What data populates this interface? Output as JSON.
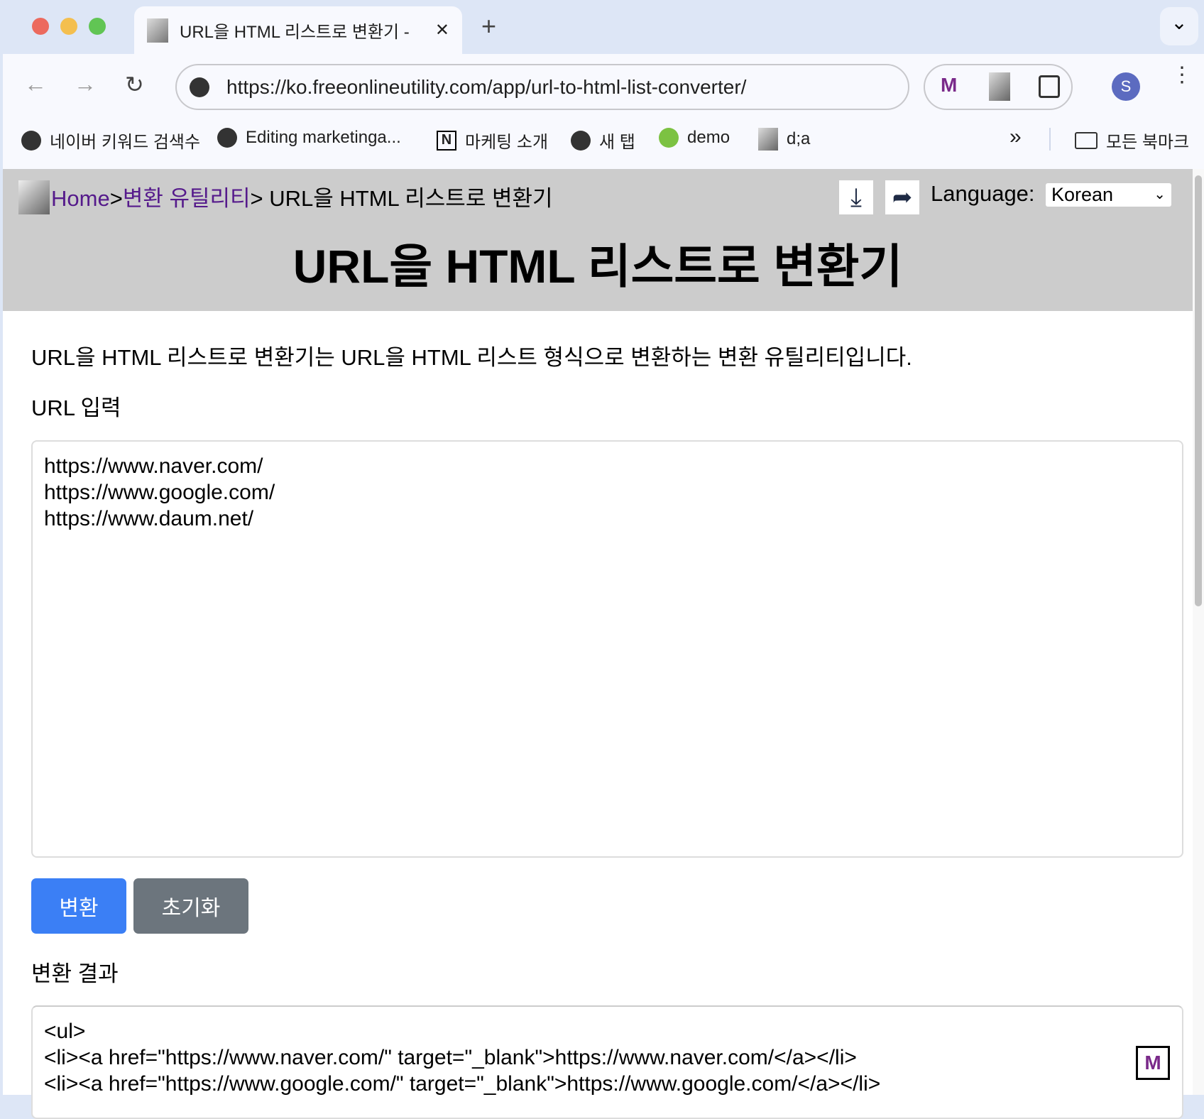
{
  "browser": {
    "tab_title": "URL을 HTML 리스트로 변환기 - ",
    "tab_close": "✕",
    "new_tab": "+",
    "tab_menu": "⌄",
    "url": "https://ko.freeonlineutility.com/app/url-to-html-list-converter/",
    "avatar": "S",
    "bookmarks": [
      "네이버 키워드 검색수",
      "Editing marketinga...",
      "마케팅 소개",
      "새 탭",
      "demo",
      "d;a"
    ],
    "more_bookmarks": "»",
    "all_bookmarks": "모든 북마크"
  },
  "header": {
    "breadcrumb_home": "Home",
    "sep1": ">",
    "breadcrumb_cat": "변환 유틸리티",
    "breadcrumb_current": "> URL을 HTML 리스트로 변환기",
    "language_label": "Language:",
    "language_value": "Korean",
    "title": "URL을 HTML 리스트로 변환기"
  },
  "main": {
    "description": "URL을 HTML 리스트로 변환기는 URL을 HTML 리스트 형식으로 변환하는 변환 유틸리티입니다.",
    "input_label": "URL 입력",
    "input_value": "https://www.naver.com/\nhttps://www.google.com/\nhttps://www.daum.net/",
    "convert_label": "변환",
    "reset_label": "초기화",
    "output_label": "변환 결과",
    "output_value": "<ul>\n<li><a href=\"https://www.naver.com/\" target=\"_blank\">https://www.naver.com/</a></li>\n<li><a href=\"https://www.google.com/\" target=\"_blank\">https://www.google.com/</a></li>"
  },
  "colors": {
    "primary": "#3b7ff5",
    "secondary": "#6c757d",
    "link": "#551a8b",
    "header_bg": "#cccccc"
  }
}
